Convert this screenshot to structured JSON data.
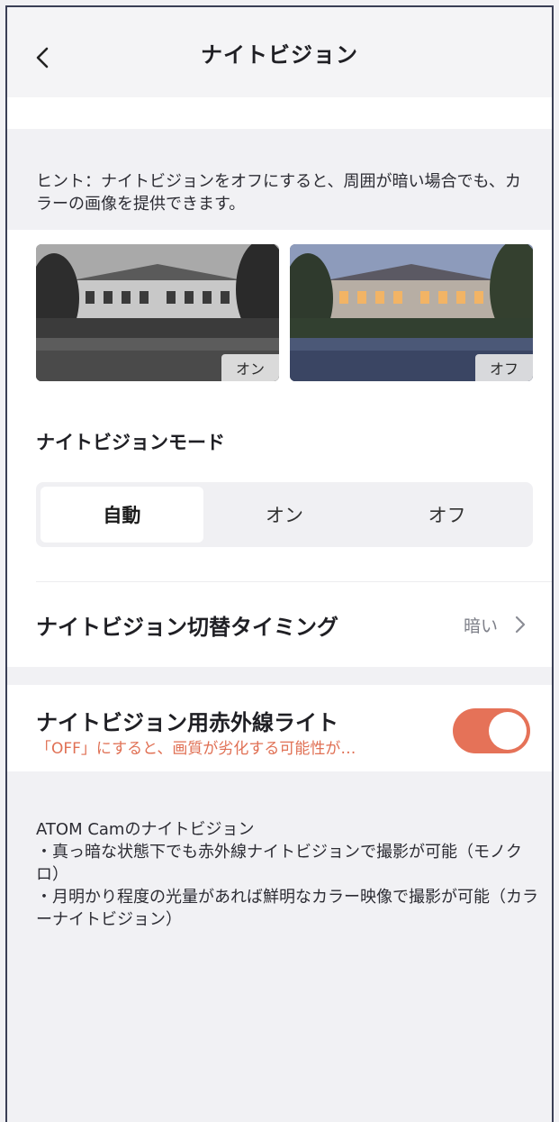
{
  "header": {
    "title": "ナイトビジョン",
    "back_icon": "chevron-left-icon"
  },
  "hint": {
    "text": "ヒント：ナイトビジョンをオフにすると、周囲が暗い場合でも、カラーの画像を提供できます。"
  },
  "previews": [
    {
      "label": "オン",
      "style": "monochrome"
    },
    {
      "label": "オフ",
      "style": "color"
    }
  ],
  "mode": {
    "title": "ナイトビジョンモード",
    "options": [
      "自動",
      "オン",
      "オフ"
    ],
    "selected": "自動"
  },
  "timing": {
    "label": "ナイトビジョン切替タイミング",
    "value": "暗い",
    "chevron_icon": "chevron-right-icon"
  },
  "ir_light": {
    "title": "ナイトビジョン用赤外線ライト",
    "subtitle": "「OFF」にすると、画質が劣化する可能性が…",
    "enabled": true
  },
  "info": {
    "line1": "ATOM Camのナイトビジョン",
    "line2": "・真っ暗な状態下でも赤外線ナイトビジョンで撮影が可能（モノクロ）",
    "line3": "・月明かり程度の光量があれば鮮明なカラー映像で撮影が可能（カラーナイトビジョン）"
  },
  "colors": {
    "accent": "#e57258",
    "background": "#f1f1f4",
    "text": "#1f1f24"
  }
}
